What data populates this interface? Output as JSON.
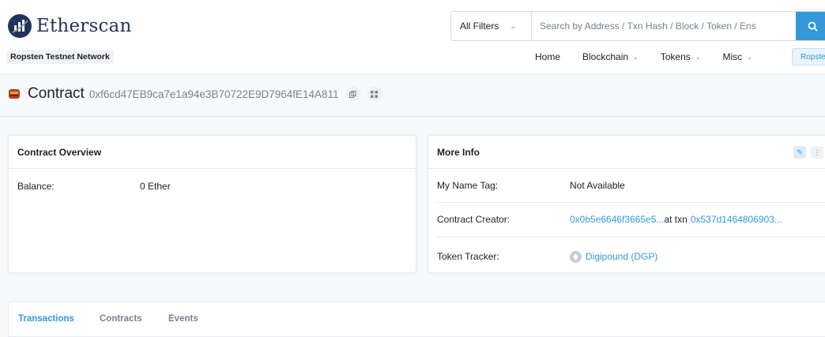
{
  "header": {
    "brand": "Etherscan",
    "network_badge": "Ropsten Testnet Network",
    "search": {
      "filter_label": "All Filters",
      "placeholder": "Search by Address / Txn Hash / Block / Token / Ens"
    },
    "nav": {
      "home": "Home",
      "blockchain": "Blockchain",
      "tokens": "Tokens",
      "misc": "Misc",
      "network": "Ropsten"
    }
  },
  "title": {
    "label": "Contract",
    "address": "0xf6cd47EB9ca7e1a94e3B70722E9D7964fE14A811"
  },
  "overview": {
    "heading": "Contract Overview",
    "balance_label": "Balance:",
    "balance_value": "0 Ether"
  },
  "more_info": {
    "heading": "More Info",
    "name_tag_label": "My Name Tag:",
    "name_tag_value": "Not Available",
    "creator_label": "Contract Creator:",
    "creator_address": "0x0b5e6646f3665e5...",
    "creator_at_txn": "at txn",
    "creator_txn": "0x537d1464806903...",
    "token_tracker_label": "Token Tracker:",
    "token_tracker_value": "Digipound (DGP)"
  },
  "tabs": {
    "transactions": "Transactions",
    "contracts": "Contracts",
    "events": "Events"
  },
  "colors": {
    "accent": "#3498db",
    "brand": "#21325b",
    "muted": "#77838f"
  }
}
